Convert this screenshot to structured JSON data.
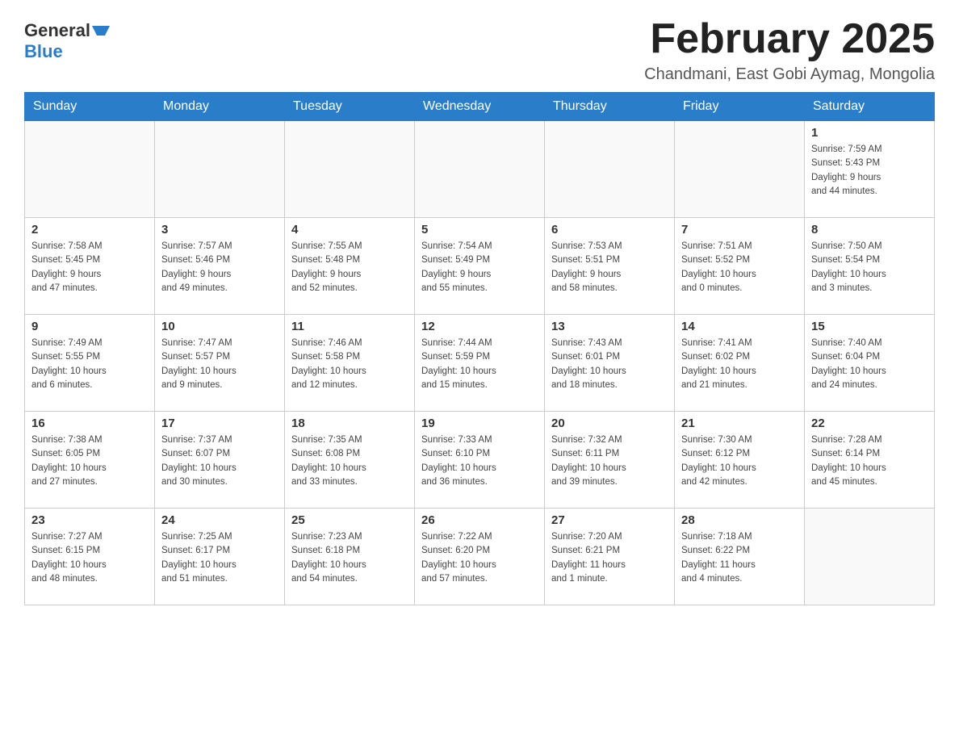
{
  "header": {
    "logo_general": "General",
    "logo_blue": "Blue",
    "month_title": "February 2025",
    "location": "Chandmani, East Gobi Aymag, Mongolia"
  },
  "days_of_week": [
    "Sunday",
    "Monday",
    "Tuesday",
    "Wednesday",
    "Thursday",
    "Friday",
    "Saturday"
  ],
  "weeks": [
    [
      {
        "day": "",
        "info": ""
      },
      {
        "day": "",
        "info": ""
      },
      {
        "day": "",
        "info": ""
      },
      {
        "day": "",
        "info": ""
      },
      {
        "day": "",
        "info": ""
      },
      {
        "day": "",
        "info": ""
      },
      {
        "day": "1",
        "info": "Sunrise: 7:59 AM\nSunset: 5:43 PM\nDaylight: 9 hours\nand 44 minutes."
      }
    ],
    [
      {
        "day": "2",
        "info": "Sunrise: 7:58 AM\nSunset: 5:45 PM\nDaylight: 9 hours\nand 47 minutes."
      },
      {
        "day": "3",
        "info": "Sunrise: 7:57 AM\nSunset: 5:46 PM\nDaylight: 9 hours\nand 49 minutes."
      },
      {
        "day": "4",
        "info": "Sunrise: 7:55 AM\nSunset: 5:48 PM\nDaylight: 9 hours\nand 52 minutes."
      },
      {
        "day": "5",
        "info": "Sunrise: 7:54 AM\nSunset: 5:49 PM\nDaylight: 9 hours\nand 55 minutes."
      },
      {
        "day": "6",
        "info": "Sunrise: 7:53 AM\nSunset: 5:51 PM\nDaylight: 9 hours\nand 58 minutes."
      },
      {
        "day": "7",
        "info": "Sunrise: 7:51 AM\nSunset: 5:52 PM\nDaylight: 10 hours\nand 0 minutes."
      },
      {
        "day": "8",
        "info": "Sunrise: 7:50 AM\nSunset: 5:54 PM\nDaylight: 10 hours\nand 3 minutes."
      }
    ],
    [
      {
        "day": "9",
        "info": "Sunrise: 7:49 AM\nSunset: 5:55 PM\nDaylight: 10 hours\nand 6 minutes."
      },
      {
        "day": "10",
        "info": "Sunrise: 7:47 AM\nSunset: 5:57 PM\nDaylight: 10 hours\nand 9 minutes."
      },
      {
        "day": "11",
        "info": "Sunrise: 7:46 AM\nSunset: 5:58 PM\nDaylight: 10 hours\nand 12 minutes."
      },
      {
        "day": "12",
        "info": "Sunrise: 7:44 AM\nSunset: 5:59 PM\nDaylight: 10 hours\nand 15 minutes."
      },
      {
        "day": "13",
        "info": "Sunrise: 7:43 AM\nSunset: 6:01 PM\nDaylight: 10 hours\nand 18 minutes."
      },
      {
        "day": "14",
        "info": "Sunrise: 7:41 AM\nSunset: 6:02 PM\nDaylight: 10 hours\nand 21 minutes."
      },
      {
        "day": "15",
        "info": "Sunrise: 7:40 AM\nSunset: 6:04 PM\nDaylight: 10 hours\nand 24 minutes."
      }
    ],
    [
      {
        "day": "16",
        "info": "Sunrise: 7:38 AM\nSunset: 6:05 PM\nDaylight: 10 hours\nand 27 minutes."
      },
      {
        "day": "17",
        "info": "Sunrise: 7:37 AM\nSunset: 6:07 PM\nDaylight: 10 hours\nand 30 minutes."
      },
      {
        "day": "18",
        "info": "Sunrise: 7:35 AM\nSunset: 6:08 PM\nDaylight: 10 hours\nand 33 minutes."
      },
      {
        "day": "19",
        "info": "Sunrise: 7:33 AM\nSunset: 6:10 PM\nDaylight: 10 hours\nand 36 minutes."
      },
      {
        "day": "20",
        "info": "Sunrise: 7:32 AM\nSunset: 6:11 PM\nDaylight: 10 hours\nand 39 minutes."
      },
      {
        "day": "21",
        "info": "Sunrise: 7:30 AM\nSunset: 6:12 PM\nDaylight: 10 hours\nand 42 minutes."
      },
      {
        "day": "22",
        "info": "Sunrise: 7:28 AM\nSunset: 6:14 PM\nDaylight: 10 hours\nand 45 minutes."
      }
    ],
    [
      {
        "day": "23",
        "info": "Sunrise: 7:27 AM\nSunset: 6:15 PM\nDaylight: 10 hours\nand 48 minutes."
      },
      {
        "day": "24",
        "info": "Sunrise: 7:25 AM\nSunset: 6:17 PM\nDaylight: 10 hours\nand 51 minutes."
      },
      {
        "day": "25",
        "info": "Sunrise: 7:23 AM\nSunset: 6:18 PM\nDaylight: 10 hours\nand 54 minutes."
      },
      {
        "day": "26",
        "info": "Sunrise: 7:22 AM\nSunset: 6:20 PM\nDaylight: 10 hours\nand 57 minutes."
      },
      {
        "day": "27",
        "info": "Sunrise: 7:20 AM\nSunset: 6:21 PM\nDaylight: 11 hours\nand 1 minute."
      },
      {
        "day": "28",
        "info": "Sunrise: 7:18 AM\nSunset: 6:22 PM\nDaylight: 11 hours\nand 4 minutes."
      },
      {
        "day": "",
        "info": ""
      }
    ]
  ]
}
